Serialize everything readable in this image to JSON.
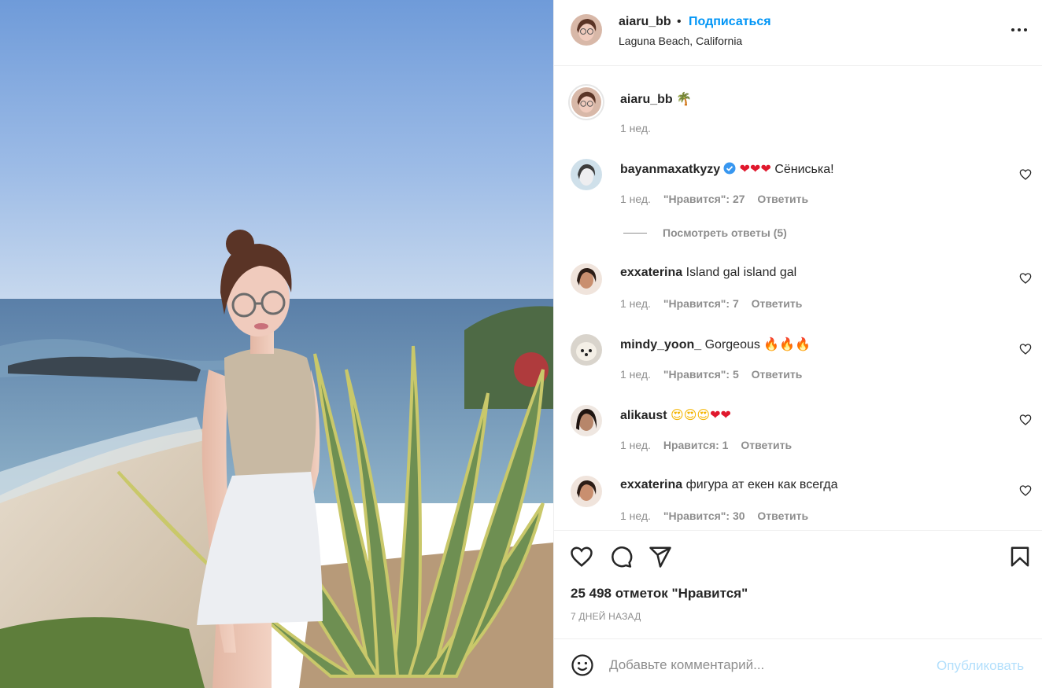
{
  "post": {
    "author": "aiaru_bb",
    "separator": "•",
    "follow_label": "Подписаться",
    "location": "Laguna Beach, California",
    "caption": {
      "username": "aiaru_bb",
      "emoji": "🌴",
      "time": "1 нед."
    }
  },
  "comments": [
    {
      "username": "bayanmaxatkyzy",
      "verified": true,
      "emoji": "❤❤❤",
      "text": "Сёниська!",
      "time": "1 нед.",
      "likes": "\"Нравится\": 27",
      "reply": "Ответить"
    },
    {
      "username": "exxaterina",
      "text": "Island gal island gal",
      "time": "1 нед.",
      "likes": "\"Нравится\": 7",
      "reply": "Ответить"
    },
    {
      "username": "mindy_yoon_",
      "text": "Gorgeous",
      "emoji": "🔥🔥🔥",
      "time": "1 нед.",
      "likes": "\"Нравится\": 5",
      "reply": "Ответить"
    },
    {
      "username": "alikaust",
      "emoji_a": "😍😍😍",
      "emoji_b": "❤❤",
      "time": "1 нед.",
      "likes": "Нравится: 1",
      "reply": "Ответить"
    },
    {
      "username": "exxaterina",
      "text": "фигура ат екен как всегда",
      "time": "1 нед.",
      "likes": "\"Нравится\": 30",
      "reply": "Ответить"
    }
  ],
  "view_replies": "Посмотреть ответы (5)",
  "likes_total": "25 498 отметок \"Нравится\"",
  "posted": "7 ДНЕЙ НАЗАД",
  "add_comment": {
    "placeholder": "Добавьте комментарий...",
    "publish_label": "Опубликовать"
  },
  "colors": {
    "accent": "#0095f6",
    "publish_disabled": "#b2dffc",
    "muted": "#8e8e8e",
    "text": "#262626",
    "heart_red": "#e0182d"
  },
  "icons": [
    "more-icon",
    "heart-icon",
    "comment-icon",
    "share-icon",
    "bookmark-icon",
    "emoji-icon",
    "verified-icon"
  ]
}
